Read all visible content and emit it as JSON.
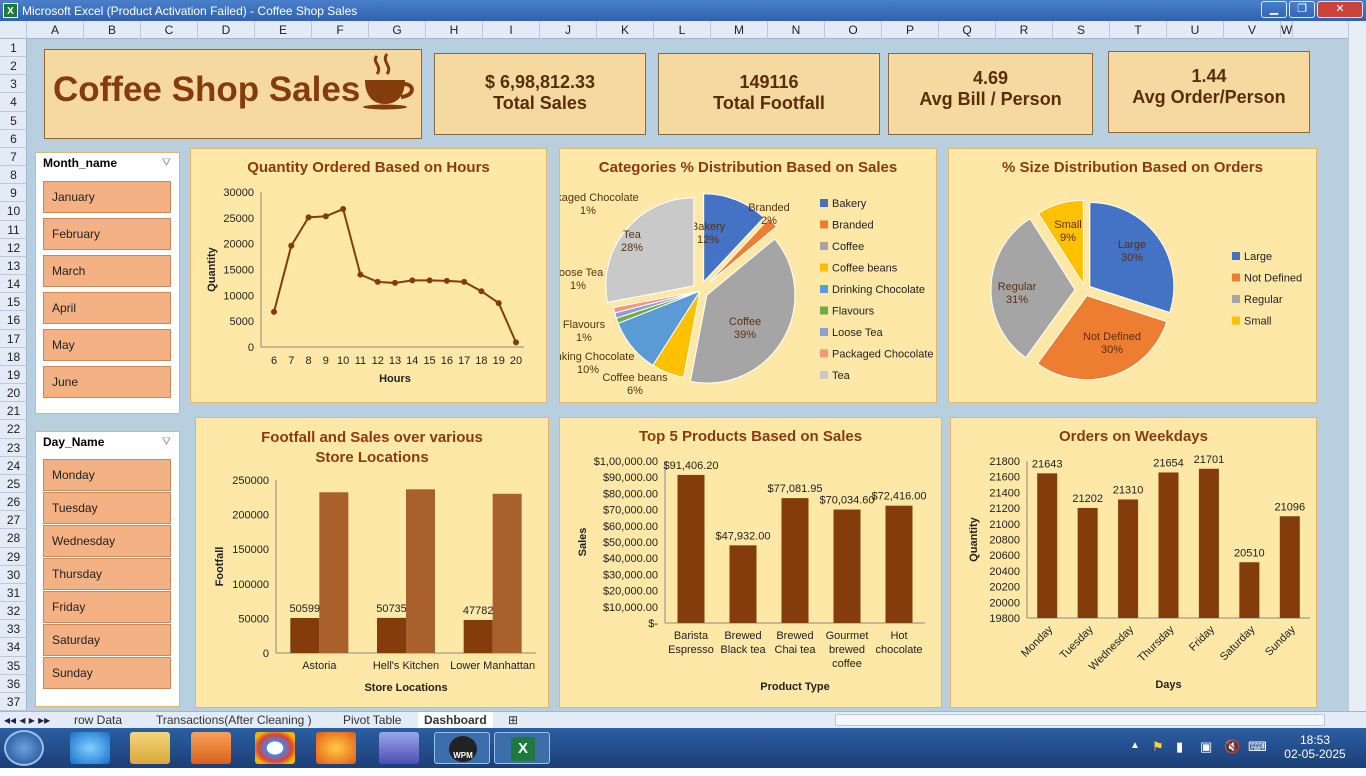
{
  "window": {
    "title": "Microsoft Excel (Product Activation Failed) - Coffee Shop Sales",
    "minimize": "▁",
    "restore": "❐",
    "close": "✕"
  },
  "columns": [
    "A",
    "B",
    "C",
    "D",
    "E",
    "F",
    "G",
    "H",
    "I",
    "J",
    "K",
    "L",
    "M",
    "N",
    "O",
    "P",
    "Q",
    "R",
    "S",
    "T",
    "U",
    "V",
    "W"
  ],
  "rows": [
    "1",
    "2",
    "3",
    "4",
    "5",
    "6",
    "7",
    "8",
    "9",
    "10",
    "11",
    "12",
    "13",
    "14",
    "15",
    "16",
    "17",
    "18",
    "19",
    "20",
    "21",
    "22",
    "23",
    "24",
    "25",
    "26",
    "27",
    "28",
    "29",
    "30",
    "31",
    "32",
    "33",
    "34",
    "35",
    "36",
    "37"
  ],
  "header": {
    "title": "Coffee Shop Sales"
  },
  "kpis": [
    {
      "value": "$  6,98,812.33",
      "label": "Total Sales"
    },
    {
      "value": "149116",
      "label": "Total Footfall"
    },
    {
      "value": "4.69",
      "label": "Avg Bill / Person"
    },
    {
      "value": "1.44",
      "label": "Avg Order/Person"
    }
  ],
  "slicers": {
    "month": {
      "title": "Month_name",
      "items": [
        "January",
        "February",
        "March",
        "April",
        "May",
        "June"
      ]
    },
    "day": {
      "title": "Day_Name",
      "items": [
        "Monday",
        "Tuesday",
        "Wednesday",
        "Thursday",
        "Friday",
        "Saturday",
        "Sunday"
      ]
    }
  },
  "chart_data": [
    {
      "type": "line",
      "title": "Quantity Ordered Based on Hours",
      "xlabel": "Hours",
      "ylabel": "Quantity",
      "x": [
        6,
        7,
        8,
        9,
        10,
        11,
        12,
        13,
        14,
        15,
        16,
        17,
        18,
        19,
        20
      ],
      "values": [
        6800,
        19600,
        25100,
        25300,
        26700,
        14000,
        12600,
        12400,
        12900,
        12900,
        12800,
        12600,
        10800,
        8500,
        900
      ],
      "yticks": [
        "0",
        "5000",
        "10000",
        "15000",
        "20000",
        "25000",
        "30000"
      ],
      "ylim": [
        0,
        30000
      ],
      "color": "#843c0c"
    },
    {
      "type": "pie",
      "title": "Categories % Distribution Based on Sales",
      "categories": [
        "Bakery",
        "Branded",
        "Coffee",
        "Coffee beans",
        "Drinking Chocolate",
        "Flavours",
        "Loose Tea",
        "Packaged Chocolate",
        "Tea"
      ],
      "values": [
        12,
        2,
        39,
        6,
        10,
        1,
        1,
        1,
        28
      ],
      "labels": [
        "12%",
        "2%",
        "39%",
        "6%",
        "10%",
        "1%",
        "1%",
        "1%",
        "28%"
      ],
      "colors": [
        "#4472c4",
        "#ed7d31",
        "#a5a5a5",
        "#ffc000",
        "#5b9bd5",
        "#70ad47",
        "#8e9fd8",
        "#f2997d",
        "#c9c9c9"
      ]
    },
    {
      "type": "pie",
      "title": "% Size Distribution Based on Orders",
      "categories": [
        "Large",
        "Not Defined",
        "Regular",
        "Small"
      ],
      "values": [
        30,
        30,
        31,
        9
      ],
      "labels": [
        "30%",
        "30%",
        "31%",
        "9%"
      ],
      "colors": [
        "#4472c4",
        "#ed7d31",
        "#a5a5a5",
        "#ffc000"
      ]
    },
    {
      "type": "bar",
      "title": "Footfall and Sales over various Store Locations",
      "xlabel": "Store Locations",
      "ylabel": "Footfall",
      "categories": [
        "Astoria",
        "Hell's Kitchen",
        "Lower Manhattan"
      ],
      "series": [
        {
          "values": [
            50599,
            50735,
            47782
          ],
          "labels": [
            "50599",
            "50735",
            "47782"
          ],
          "color": "#843c0c"
        },
        {
          "values": [
            232243,
            236511,
            230057
          ],
          "color": "#a9602a"
        }
      ],
      "yticks": [
        "0",
        "50000",
        "100000",
        "150000",
        "200000",
        "250000"
      ],
      "ylim": [
        0,
        250000
      ]
    },
    {
      "type": "bar",
      "title": "Top 5 Products Based on Sales",
      "xlabel": "Product Type",
      "ylabel": "Sales",
      "categories": [
        "Barista Espresso",
        "Brewed Black tea",
        "Brewed Chai tea",
        "Gourmet brewed coffee",
        "Hot chocolate"
      ],
      "values": [
        91406.2,
        47932,
        77081.95,
        70034.6,
        72416
      ],
      "labels": [
        "$91,406.20",
        "$47,932.00",
        "$77,081.95",
        "$70,034.60",
        "$72,416.00"
      ],
      "yticks": [
        "$-",
        "$10,000.00",
        "$20,000.00",
        "$30,000.00",
        "$40,000.00",
        "$50,000.00",
        "$60,000.00",
        "$70,000.00",
        "$80,000.00",
        "$90,000.00",
        "$1,00,000.00"
      ],
      "ylim": [
        0,
        100000
      ],
      "color": "#843c0c"
    },
    {
      "type": "bar",
      "title": "Orders on Weekdays",
      "xlabel": "Days",
      "ylabel": "Quantity",
      "categories": [
        "Monday",
        "Tuesday",
        "Wednesday",
        "Thursday",
        "Friday",
        "Saturday",
        "Sunday"
      ],
      "values": [
        21643,
        21202,
        21310,
        21654,
        21701,
        20510,
        21096
      ],
      "labels": [
        "21643",
        "21202",
        "21310",
        "21654",
        "21701",
        "20510",
        "21096"
      ],
      "yticks": [
        "19800",
        "20000",
        "20200",
        "20400",
        "20600",
        "20800",
        "21000",
        "21200",
        "21400",
        "21600",
        "21800"
      ],
      "ylim": [
        19800,
        21800
      ],
      "color": "#843c0c"
    }
  ],
  "tabs": [
    "row Data",
    "Transactions(After Cleaning )",
    "Pivot Table",
    "Dashboard"
  ],
  "taskbar": {
    "time": "18:53",
    "date": "02-05-2025",
    "wpm": "WPM"
  }
}
